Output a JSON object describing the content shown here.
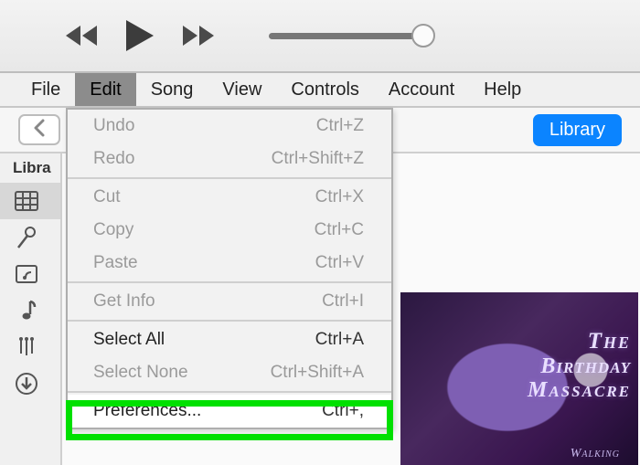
{
  "menubar": {
    "items": [
      "File",
      "Edit",
      "Song",
      "View",
      "Controls",
      "Account",
      "Help"
    ],
    "active_index": 1
  },
  "toolbar": {
    "library_label": "Library"
  },
  "sidebar": {
    "title": "Libra"
  },
  "dropdown": {
    "groups": [
      [
        {
          "label": "Undo",
          "shortcut": "Ctrl+Z",
          "enabled": false
        },
        {
          "label": "Redo",
          "shortcut": "Ctrl+Shift+Z",
          "enabled": false
        }
      ],
      [
        {
          "label": "Cut",
          "shortcut": "Ctrl+X",
          "enabled": false
        },
        {
          "label": "Copy",
          "shortcut": "Ctrl+C",
          "enabled": false
        },
        {
          "label": "Paste",
          "shortcut": "Ctrl+V",
          "enabled": false
        }
      ],
      [
        {
          "label": "Get Info",
          "shortcut": "Ctrl+I",
          "enabled": false
        }
      ],
      [
        {
          "label": "Select All",
          "shortcut": "Ctrl+A",
          "enabled": true
        },
        {
          "label": "Select None",
          "shortcut": "Ctrl+Shift+A",
          "enabled": false
        }
      ],
      [
        {
          "label": "Preferences...",
          "shortcut": "Ctrl+,",
          "enabled": true
        }
      ]
    ]
  },
  "album": {
    "line1": "The",
    "line2": "Birthday",
    "line3": "Massacre",
    "subtitle": "Walking"
  },
  "colors": {
    "highlight": "#00e000",
    "primary_button": "#0b84ff"
  }
}
